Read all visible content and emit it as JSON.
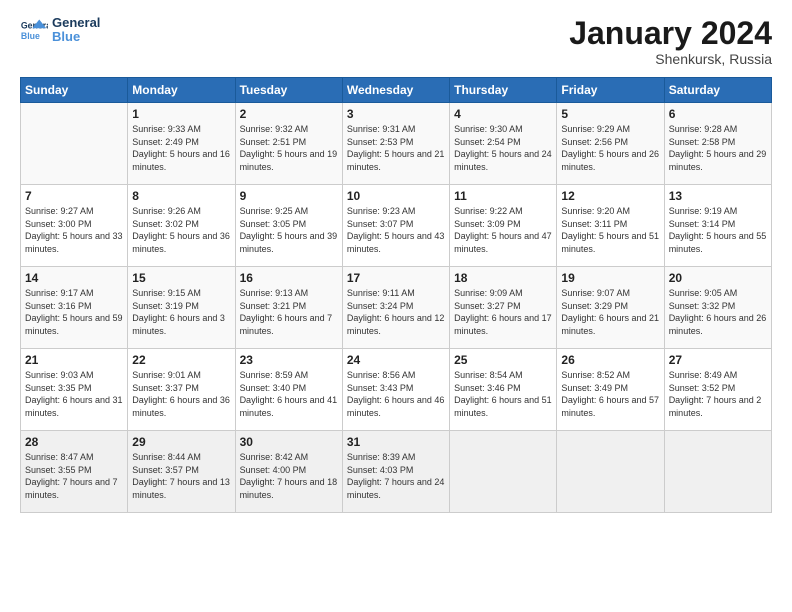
{
  "logo": {
    "line1": "General",
    "line2": "Blue"
  },
  "title": "January 2024",
  "subtitle": "Shenkursk, Russia",
  "header": {
    "days": [
      "Sunday",
      "Monday",
      "Tuesday",
      "Wednesday",
      "Thursday",
      "Friday",
      "Saturday"
    ]
  },
  "weeks": [
    [
      {
        "day": "",
        "sunrise": "",
        "sunset": "",
        "daylight": ""
      },
      {
        "day": "1",
        "sunrise": "9:33 AM",
        "sunset": "2:49 PM",
        "daylight": "5 hours and 16 minutes."
      },
      {
        "day": "2",
        "sunrise": "9:32 AM",
        "sunset": "2:51 PM",
        "daylight": "5 hours and 19 minutes."
      },
      {
        "day": "3",
        "sunrise": "9:31 AM",
        "sunset": "2:53 PM",
        "daylight": "5 hours and 21 minutes."
      },
      {
        "day": "4",
        "sunrise": "9:30 AM",
        "sunset": "2:54 PM",
        "daylight": "5 hours and 24 minutes."
      },
      {
        "day": "5",
        "sunrise": "9:29 AM",
        "sunset": "2:56 PM",
        "daylight": "5 hours and 26 minutes."
      },
      {
        "day": "6",
        "sunrise": "9:28 AM",
        "sunset": "2:58 PM",
        "daylight": "5 hours and 29 minutes."
      }
    ],
    [
      {
        "day": "7",
        "sunrise": "9:27 AM",
        "sunset": "3:00 PM",
        "daylight": "5 hours and 33 minutes."
      },
      {
        "day": "8",
        "sunrise": "9:26 AM",
        "sunset": "3:02 PM",
        "daylight": "5 hours and 36 minutes."
      },
      {
        "day": "9",
        "sunrise": "9:25 AM",
        "sunset": "3:05 PM",
        "daylight": "5 hours and 39 minutes."
      },
      {
        "day": "10",
        "sunrise": "9:23 AM",
        "sunset": "3:07 PM",
        "daylight": "5 hours and 43 minutes."
      },
      {
        "day": "11",
        "sunrise": "9:22 AM",
        "sunset": "3:09 PM",
        "daylight": "5 hours and 47 minutes."
      },
      {
        "day": "12",
        "sunrise": "9:20 AM",
        "sunset": "3:11 PM",
        "daylight": "5 hours and 51 minutes."
      },
      {
        "day": "13",
        "sunrise": "9:19 AM",
        "sunset": "3:14 PM",
        "daylight": "5 hours and 55 minutes."
      }
    ],
    [
      {
        "day": "14",
        "sunrise": "9:17 AM",
        "sunset": "3:16 PM",
        "daylight": "5 hours and 59 minutes."
      },
      {
        "day": "15",
        "sunrise": "9:15 AM",
        "sunset": "3:19 PM",
        "daylight": "6 hours and 3 minutes."
      },
      {
        "day": "16",
        "sunrise": "9:13 AM",
        "sunset": "3:21 PM",
        "daylight": "6 hours and 7 minutes."
      },
      {
        "day": "17",
        "sunrise": "9:11 AM",
        "sunset": "3:24 PM",
        "daylight": "6 hours and 12 minutes."
      },
      {
        "day": "18",
        "sunrise": "9:09 AM",
        "sunset": "3:27 PM",
        "daylight": "6 hours and 17 minutes."
      },
      {
        "day": "19",
        "sunrise": "9:07 AM",
        "sunset": "3:29 PM",
        "daylight": "6 hours and 21 minutes."
      },
      {
        "day": "20",
        "sunrise": "9:05 AM",
        "sunset": "3:32 PM",
        "daylight": "6 hours and 26 minutes."
      }
    ],
    [
      {
        "day": "21",
        "sunrise": "9:03 AM",
        "sunset": "3:35 PM",
        "daylight": "6 hours and 31 minutes."
      },
      {
        "day": "22",
        "sunrise": "9:01 AM",
        "sunset": "3:37 PM",
        "daylight": "6 hours and 36 minutes."
      },
      {
        "day": "23",
        "sunrise": "8:59 AM",
        "sunset": "3:40 PM",
        "daylight": "6 hours and 41 minutes."
      },
      {
        "day": "24",
        "sunrise": "8:56 AM",
        "sunset": "3:43 PM",
        "daylight": "6 hours and 46 minutes."
      },
      {
        "day": "25",
        "sunrise": "8:54 AM",
        "sunset": "3:46 PM",
        "daylight": "6 hours and 51 minutes."
      },
      {
        "day": "26",
        "sunrise": "8:52 AM",
        "sunset": "3:49 PM",
        "daylight": "6 hours and 57 minutes."
      },
      {
        "day": "27",
        "sunrise": "8:49 AM",
        "sunset": "3:52 PM",
        "daylight": "7 hours and 2 minutes."
      }
    ],
    [
      {
        "day": "28",
        "sunrise": "8:47 AM",
        "sunset": "3:55 PM",
        "daylight": "7 hours and 7 minutes."
      },
      {
        "day": "29",
        "sunrise": "8:44 AM",
        "sunset": "3:57 PM",
        "daylight": "7 hours and 13 minutes."
      },
      {
        "day": "30",
        "sunrise": "8:42 AM",
        "sunset": "4:00 PM",
        "daylight": "7 hours and 18 minutes."
      },
      {
        "day": "31",
        "sunrise": "8:39 AM",
        "sunset": "4:03 PM",
        "daylight": "7 hours and 24 minutes."
      },
      {
        "day": "",
        "sunrise": "",
        "sunset": "",
        "daylight": ""
      },
      {
        "day": "",
        "sunrise": "",
        "sunset": "",
        "daylight": ""
      },
      {
        "day": "",
        "sunrise": "",
        "sunset": "",
        "daylight": ""
      }
    ]
  ]
}
